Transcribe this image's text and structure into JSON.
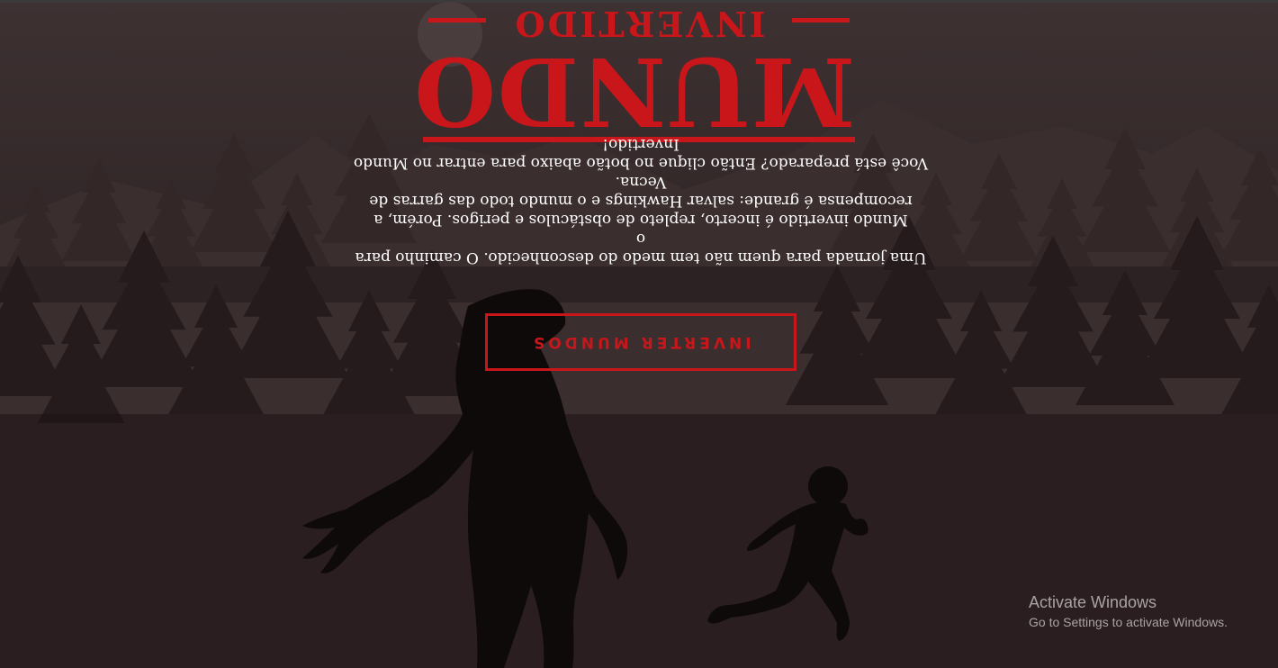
{
  "logo": {
    "main_word": "MUNDO",
    "sub_word": "INVERTIDO"
  },
  "description": {
    "lines": [
      "Uma jornada para quem não tem medo do desconhecido. O caminho para o",
      "Mundo invertido é incerto, repleto de obstáculos e perigos. Porém, a",
      "recompensa é grande: salvar Hawkings e o mundo todo das garras de Vecna.",
      "Você está preparado? Então clique no botão abaixo para entrar no Mundo",
      "Invertido!"
    ]
  },
  "cta": {
    "label": "INVERTER MUNDOS"
  },
  "watermark": {
    "title": "Activate Windows",
    "subtitle": "Go to Settings to activate Windows."
  },
  "colors": {
    "accent": "#c8161a",
    "background_top": "#3b3030",
    "background_bottom": "#1e1314",
    "silhouette": "#0e0a0a"
  }
}
